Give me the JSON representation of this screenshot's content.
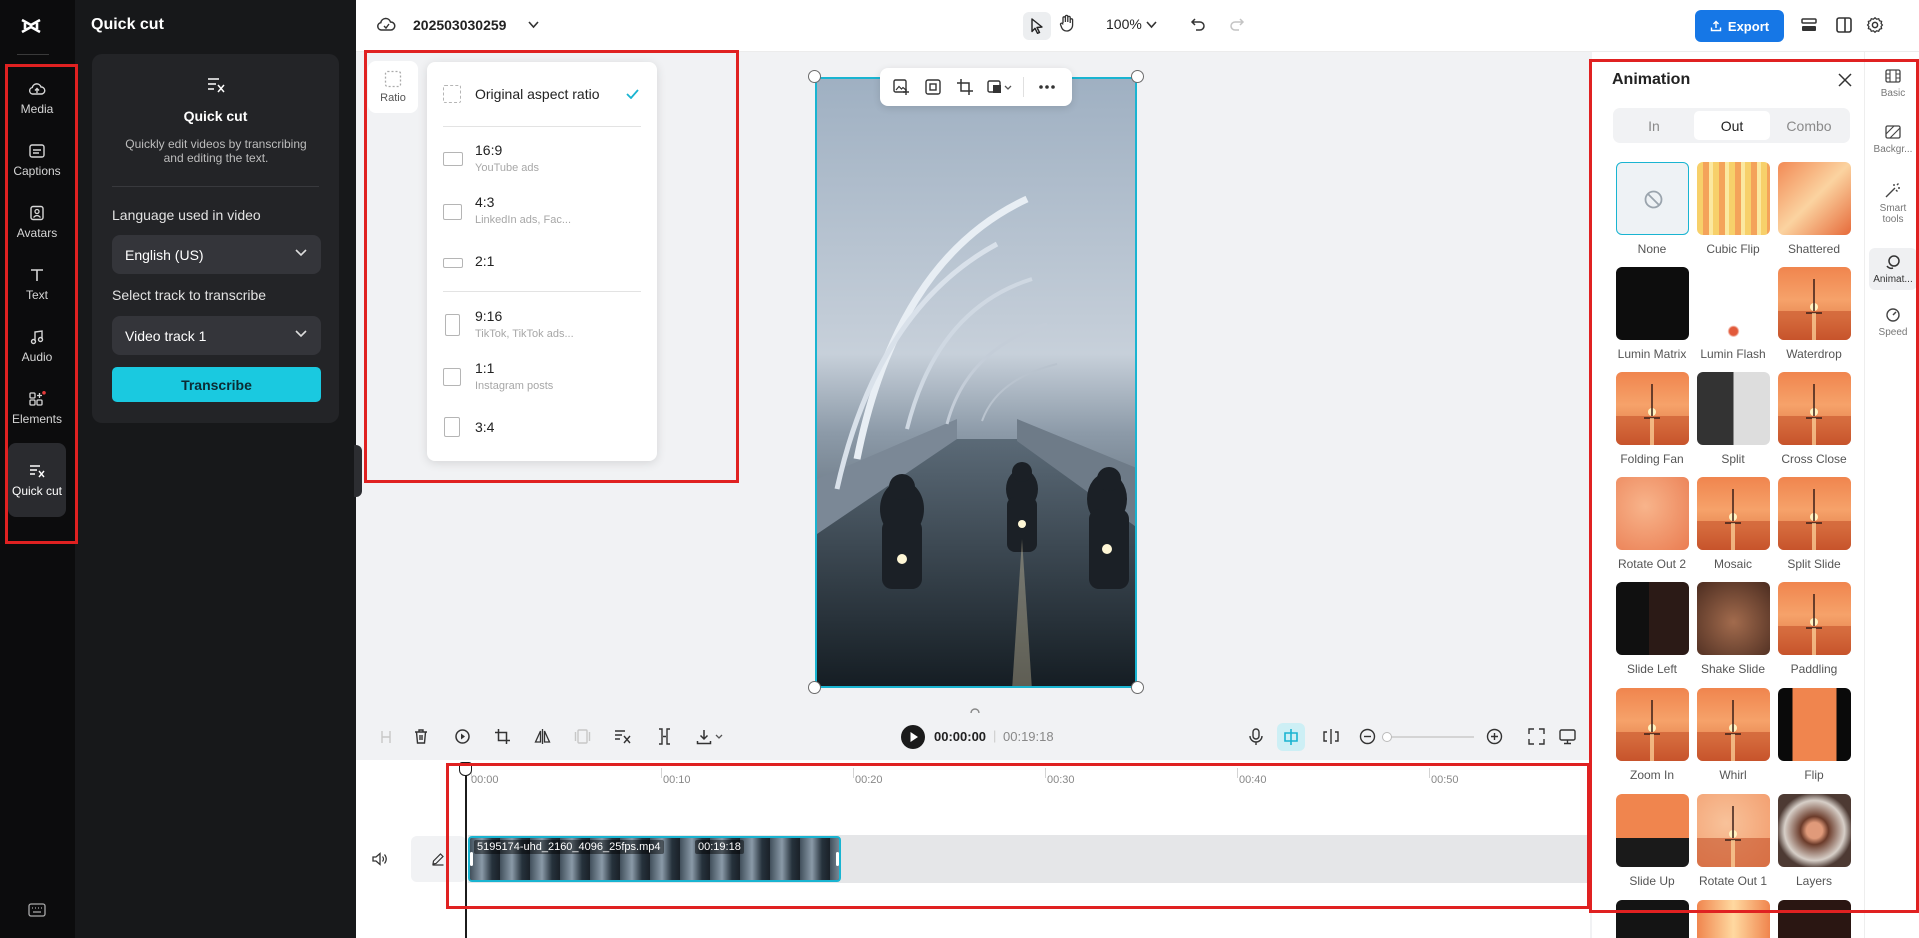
{
  "app": {
    "logo": "capcut-logo-icon",
    "panel_title": "Quick cut"
  },
  "left_rail": {
    "items": [
      {
        "label": "Media",
        "icon": "cloud-upload-icon"
      },
      {
        "label": "Captions",
        "icon": "captions-icon"
      },
      {
        "label": "Avatars",
        "icon": "avatar-icon"
      },
      {
        "label": "Text",
        "icon": "text-icon"
      },
      {
        "label": "Audio",
        "icon": "music-note-icon"
      },
      {
        "label": "Elements",
        "icon": "elements-icon"
      },
      {
        "label": "Quick cut",
        "icon": "quick-cut-icon"
      }
    ]
  },
  "quick_cut": {
    "card_title": "Quick cut",
    "description": "Quickly edit videos by transcribing and editing the text.",
    "language_label": "Language used in video",
    "language_value": "English (US)",
    "track_label": "Select track to transcribe",
    "track_value": "Video track 1",
    "transcribe_label": "Transcribe"
  },
  "topbar": {
    "project_name": "202503030259",
    "zoom": "100%",
    "export_label": "Export",
    "colors": {
      "export": "#1677e6"
    }
  },
  "ratio": {
    "button_label": "Ratio",
    "options": [
      {
        "name": "Original aspect ratio",
        "sub": "",
        "selected": true
      },
      {
        "name": "16:9",
        "sub": "YouTube ads"
      },
      {
        "name": "4:3",
        "sub": "LinkedIn ads, Fac..."
      },
      {
        "name": "2:1",
        "sub": ""
      },
      {
        "name": "9:16",
        "sub": "TikTok, TikTok ads..."
      },
      {
        "name": "1:1",
        "sub": "Instagram posts"
      },
      {
        "name": "3:4",
        "sub": ""
      }
    ]
  },
  "player": {
    "current_time": "00:00:00",
    "total_time": "00:19:18"
  },
  "timeline": {
    "ticks": [
      "00:00",
      "00:10",
      "00:20",
      "00:30",
      "00:40",
      "00:50"
    ],
    "clip": {
      "name": "5195174-uhd_2160_4096_25fps.mp4",
      "duration": "00:19:18"
    }
  },
  "animation": {
    "title": "Animation",
    "tabs": [
      "In",
      "Out",
      "Combo"
    ],
    "active_tab": "Out",
    "items": [
      "None",
      "Cubic Flip",
      "Shattered",
      "Lumin Matrix",
      "Lumin Flash",
      "Waterdrop",
      "Folding Fan",
      "Split",
      "Cross Close",
      "Rotate Out 2",
      "Mosaic",
      "Split Slide",
      "Slide Left",
      "Shake Slide",
      "Paddling",
      "Zoom In",
      "Whirl",
      "Flip",
      "Slide Up",
      "Rotate Out 1",
      "Layers"
    ]
  },
  "right_sidebar": {
    "items": [
      {
        "label": "Basic",
        "icon": "film-icon"
      },
      {
        "label": "Backgr...",
        "icon": "background-icon"
      },
      {
        "label": "Smart tools",
        "icon": "magic-wand-icon"
      },
      {
        "label": "Animat...",
        "icon": "animation-icon"
      },
      {
        "label": "Speed",
        "icon": "speed-icon"
      }
    ]
  },
  "colors": {
    "accent": "#19b4d1",
    "highlight": "#e02121",
    "transcribe": "#1ac9e0"
  }
}
